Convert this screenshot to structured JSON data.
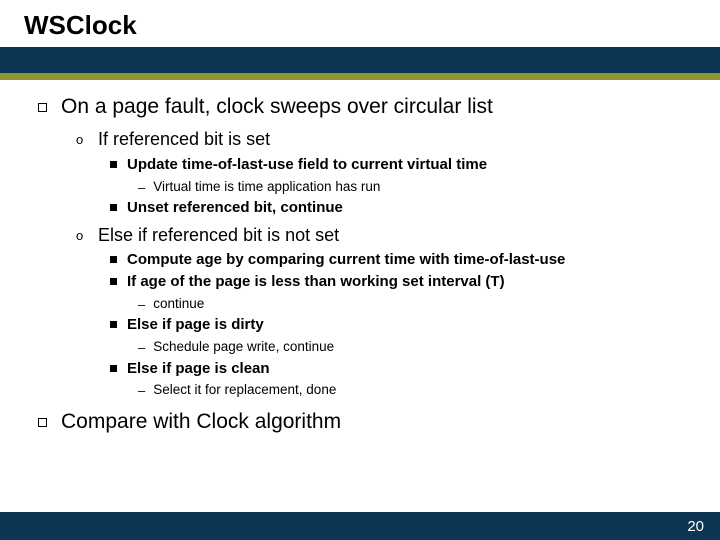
{
  "title": "WSClock",
  "bullets": {
    "b1": "On a page fault, clock sweeps over circular list",
    "b1_1": "If referenced bit is set",
    "b1_1_1": "Update time-of-last-use field to current virtual time",
    "b1_1_1_1": "Virtual time is time application has run",
    "b1_1_2": "Unset referenced bit, continue",
    "b1_2": "Else if referenced bit is not set",
    "b1_2_1": "Compute age by comparing current time with time-of-last-use",
    "b1_2_2": "If age of the page is less than working set interval (T)",
    "b1_2_2_1": "continue",
    "b1_2_3": "Else if page is dirty",
    "b1_2_3_1": "Schedule page write, continue",
    "b1_2_4": "Else if page is clean",
    "b1_2_4_1": "Select it for replacement, done",
    "b2": "Compare with Clock algorithm"
  },
  "page_number": "20"
}
